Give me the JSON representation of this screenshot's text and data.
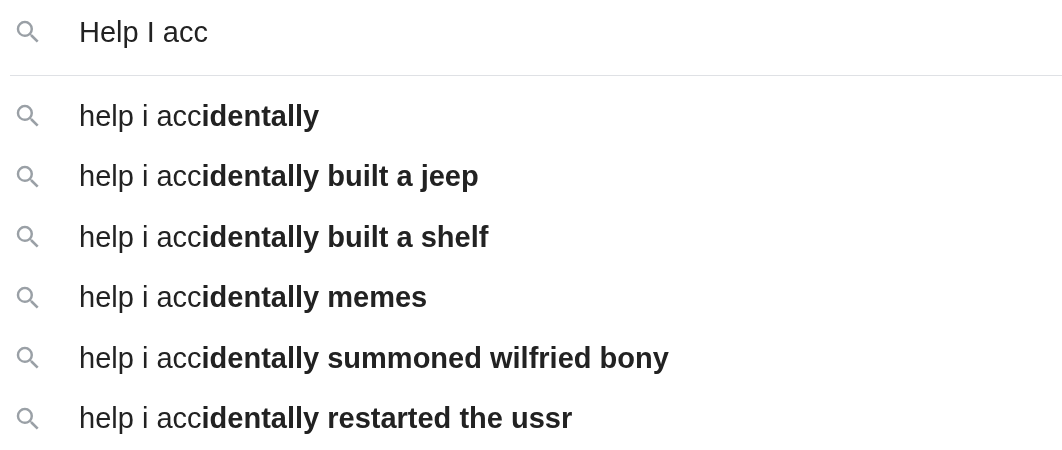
{
  "search": {
    "value": "Help I acc"
  },
  "suggestions": [
    {
      "text": "help i acc**identally**"
    },
    {
      "text": "help i acc**identally built a jeep**"
    },
    {
      "text": "help i acc**identally built a shelf**"
    },
    {
      "text": "help i acc**identally memes**"
    },
    {
      "text": "help i acc**identally summoned wilfried bony**"
    },
    {
      "text": "help i acc**identally restarted the ussr**"
    }
  ]
}
